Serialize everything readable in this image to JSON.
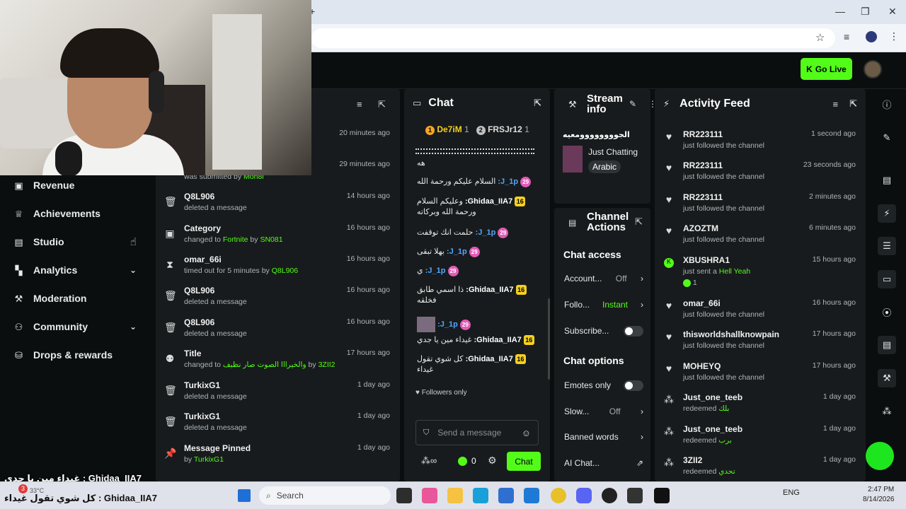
{
  "browser": {
    "new_tab_glyph": "+",
    "win_minimize": "—",
    "win_restore": "❐",
    "win_close": "✕"
  },
  "topbar": {
    "go_live": "Go Live"
  },
  "sidebar": {
    "items": [
      {
        "label": "Revenue",
        "icon": "revenue-icon"
      },
      {
        "label": "Achievements",
        "icon": "trophy-icon"
      },
      {
        "label": "Studio",
        "icon": "studio-icon"
      },
      {
        "label": "Analytics",
        "icon": "analytics-icon"
      },
      {
        "label": "Moderation",
        "icon": "wrench-icon"
      },
      {
        "label": "Community",
        "icon": "community-icon"
      },
      {
        "label": "Drops & rewards",
        "icon": "drops-icon"
      }
    ]
  },
  "modlog": {
    "partial_row": {
      "desc_prefix": "was submitted by",
      "desc_user": "Moh8i"
    },
    "rows": [
      {
        "name": "",
        "desc": "",
        "time": "20 minutes ago"
      },
      {
        "name": "",
        "desc": "",
        "time": "29 minutes ago"
      },
      {
        "name": "Q8L906",
        "desc": "deleted a message",
        "time": "14 hours ago"
      },
      {
        "name": "Category",
        "desc_prefix": "changed to",
        "desc_hl": "Fortnite",
        "desc_mid": "by",
        "desc_user": "SN081",
        "time": "16 hours ago"
      },
      {
        "name": "omar_66i",
        "desc_prefix": "timed out for 5 minutes by",
        "desc_user": "Q8L906",
        "time": "16 hours ago"
      },
      {
        "name": "Q8L906",
        "desc": "deleted a message",
        "time": "16 hours ago"
      },
      {
        "name": "Q8L906",
        "desc": "deleted a message",
        "time": "16 hours ago"
      },
      {
        "name": "Title",
        "desc_prefix": "changed to",
        "desc_hl": "والخيرااا الصوت صار نظيف",
        "desc_mid": "by",
        "desc_user": "3ZII2",
        "time": "17 hours ago"
      },
      {
        "name": "TurkixG1",
        "desc": "deleted a message",
        "time": "1 day ago"
      },
      {
        "name": "TurkixG1",
        "desc": "deleted a message",
        "time": "1 day ago"
      },
      {
        "name": "Message Pinned",
        "desc_prefix": "by",
        "desc_user": "TurkixG1",
        "time": "1 day ago"
      }
    ]
  },
  "chat": {
    "title": "Chat",
    "top_gifters": [
      {
        "name": "De7iM",
        "count": "1",
        "rank": "1"
      },
      {
        "name": "FRSJr12",
        "count": "1",
        "rank": "2"
      }
    ],
    "lines": [
      {
        "badge": "",
        "name": "",
        "text": "هه"
      },
      {
        "badge": "29",
        "name": "J_1p:",
        "text": "السلام عليكم ورحمة الله"
      },
      {
        "badge": "16",
        "name": "Ghidaa_IIA7:",
        "text": "وعليكم السلام ورحمة الله وبركاته"
      },
      {
        "badge": "29",
        "name": "J_1p:",
        "text": "حلمت انك توقفت"
      },
      {
        "badge": "29",
        "name": "J_1p:",
        "text": "بهلا تبقى"
      },
      {
        "badge": "29",
        "name": "J_1p:",
        "text": "ي"
      },
      {
        "badge": "16",
        "name": "Ghidaa_IIA7:",
        "text": "ذا اسمي طابق فخلقه"
      },
      {
        "badge": "29",
        "name": "J_1p:",
        "text": ""
      },
      {
        "badge": "16",
        "name": "Ghidaa_IIA7:",
        "text": "غيداء مين يا جدي"
      },
      {
        "badge": "16",
        "name": "Ghidaa_IIA7:",
        "text": "كل شوي تقول غيداء"
      }
    ],
    "followers_only": "Followers only",
    "input_placeholder": "Send a message",
    "kicks_count": "0",
    "send_label": "Chat"
  },
  "stream_info": {
    "title": "Stream info",
    "stream_title": "الجوووووووومعيه",
    "category": "Just Chatting",
    "language": "Arabic"
  },
  "channel_actions": {
    "title": "Channel Actions",
    "chat_access": "Chat access",
    "account_label": "Account...",
    "account_value": "Off",
    "follow_label": "Follo...",
    "follow_value": "Instant",
    "subscribe_label": "Subscribe...",
    "chat_options": "Chat options",
    "emotes_label": "Emotes only",
    "slow_label": "Slow...",
    "slow_value": "Off",
    "banned_label": "Banned words",
    "ai_label": "AI Chat..."
  },
  "activity": {
    "title": "Activity Feed",
    "items": [
      {
        "icon": "heart",
        "name": "RR223111",
        "desc": "just followed the channel",
        "time": "1 second ago"
      },
      {
        "icon": "heart",
        "name": "RR223111",
        "desc": "just followed the channel",
        "time": "23 seconds ago"
      },
      {
        "icon": "heart",
        "name": "RR223111",
        "desc": "just followed the channel",
        "time": "2 minutes ago"
      },
      {
        "icon": "heart",
        "name": "AZOZTM",
        "desc": "just followed the channel",
        "time": "6 minutes ago"
      },
      {
        "icon": "kick",
        "name": "XBUSHRA1",
        "desc_prefix": "just sent a",
        "desc_hl": "Hell Yeah",
        "extra": "1",
        "time": "15 hours ago"
      },
      {
        "icon": "heart",
        "name": "omar_66i",
        "desc": "just followed the channel",
        "time": "16 hours ago"
      },
      {
        "icon": "heart",
        "name": "thisworldshallknowpain",
        "desc": "just followed the channel",
        "time": "17 hours ago"
      },
      {
        "icon": "heart",
        "name": "MOHEYQ",
        "desc": "just followed the channel",
        "time": "17 hours ago"
      },
      {
        "icon": "redeem",
        "name": "Just_one_teeb",
        "desc_prefix": "redeemed",
        "desc_hl": "بلك",
        "time": "1 day ago"
      },
      {
        "icon": "redeem",
        "name": "Just_one_teeb",
        "desc_prefix": "redeemed",
        "desc_hl": "برب",
        "time": "1 day ago"
      },
      {
        "icon": "redeem",
        "name": "3ZII2",
        "desc_prefix": "redeemed",
        "desc_hl": "تحدي",
        "time": "1 day ago"
      }
    ]
  },
  "overlay": {
    "line1": "غيداء مين يا جدي : Ghidaa_IIA7",
    "line2": "كل شوي تقول غيداء : Ghidaa_IIA7",
    "weather_badge": "3",
    "temperature": "33°C"
  },
  "taskbar": {
    "search": "Search",
    "lang": "ENG",
    "time": "2:47 PM",
    "date": "8/14/2026"
  },
  "colors": {
    "accent": "#53fc18",
    "gold": "#f5d020",
    "panel": "#181b1d",
    "bg": "#0b0e0f"
  }
}
